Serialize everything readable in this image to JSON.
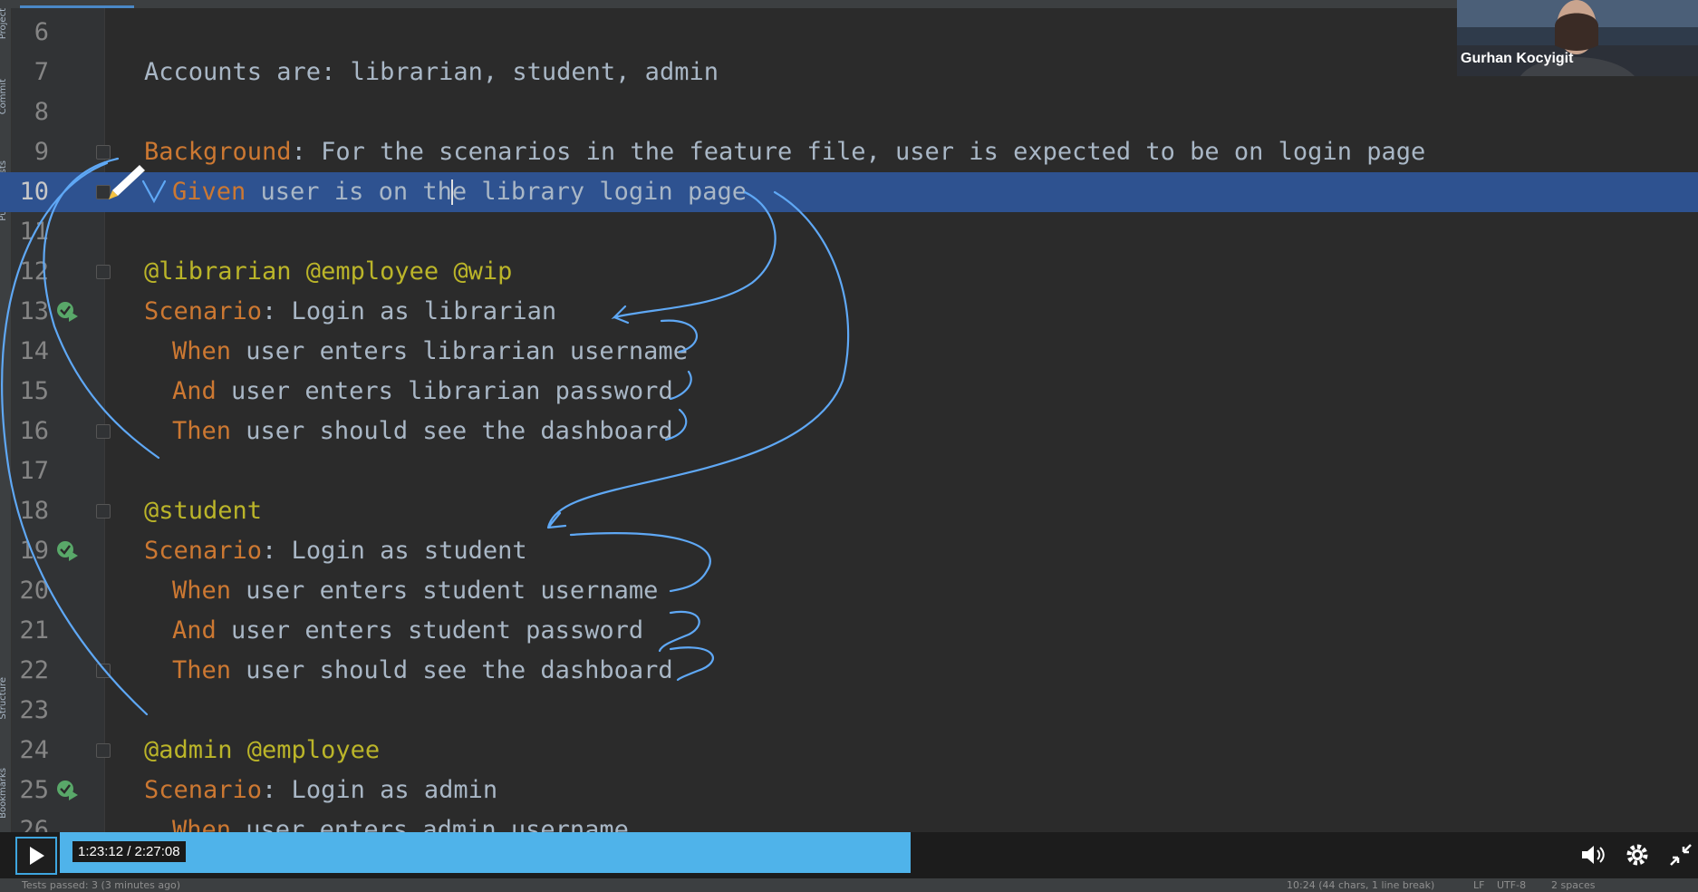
{
  "sidebar": {
    "labels": [
      "Project",
      "Commit",
      "Pull Requests",
      "Structure",
      "Bookmarks"
    ]
  },
  "editor": {
    "lines": [
      {
        "num": "6",
        "parts": []
      },
      {
        "num": "7",
        "parts": [
          {
            "t": "Accounts are: librarian, student, admin",
            "c": "plain"
          }
        ]
      },
      {
        "num": "8",
        "parts": []
      },
      {
        "num": "9",
        "parts": [
          {
            "t": "Background",
            "c": "kw"
          },
          {
            "t": ": For the scenarios in the feature file, user is expected to be on login page",
            "c": "plain"
          }
        ]
      },
      {
        "num": "10",
        "parts": [
          {
            "t": "Given",
            "c": "kw"
          },
          {
            "t": " user is on the library login page",
            "c": "plain"
          }
        ]
      },
      {
        "num": "11",
        "parts": []
      },
      {
        "num": "12",
        "parts": [
          {
            "t": "@librarian @employee @wip",
            "c": "tag"
          }
        ]
      },
      {
        "num": "13",
        "parts": [
          {
            "t": "Scenario",
            "c": "kw"
          },
          {
            "t": ": Login as librarian",
            "c": "plain"
          }
        ]
      },
      {
        "num": "14",
        "parts": [
          {
            "t": "When",
            "c": "kw"
          },
          {
            "t": " user enters librarian username",
            "c": "plain"
          }
        ]
      },
      {
        "num": "15",
        "parts": [
          {
            "t": "And",
            "c": "kw"
          },
          {
            "t": " user enters librarian password",
            "c": "plain"
          }
        ]
      },
      {
        "num": "16",
        "parts": [
          {
            "t": "Then",
            "c": "kw"
          },
          {
            "t": " user should see the dashboard",
            "c": "plain"
          }
        ]
      },
      {
        "num": "17",
        "parts": []
      },
      {
        "num": "18",
        "parts": [
          {
            "t": "@student",
            "c": "tag"
          }
        ]
      },
      {
        "num": "19",
        "parts": [
          {
            "t": "Scenario",
            "c": "kw"
          },
          {
            "t": ": Login as student",
            "c": "plain"
          }
        ]
      },
      {
        "num": "20",
        "parts": [
          {
            "t": "When",
            "c": "kw"
          },
          {
            "t": " user enters student username",
            "c": "plain"
          }
        ]
      },
      {
        "num": "21",
        "parts": [
          {
            "t": "And",
            "c": "kw"
          },
          {
            "t": " user enters student password",
            "c": "plain"
          }
        ]
      },
      {
        "num": "22",
        "parts": [
          {
            "t": "Then",
            "c": "kw"
          },
          {
            "t": " user should see the dashboard",
            "c": "plain"
          }
        ]
      },
      {
        "num": "23",
        "parts": []
      },
      {
        "num": "24",
        "parts": [
          {
            "t": "@admin @employee",
            "c": "tag"
          }
        ]
      },
      {
        "num": "25",
        "parts": [
          {
            "t": "Scenario",
            "c": "kw"
          },
          {
            "t": ": Login as admin",
            "c": "plain"
          }
        ]
      },
      {
        "num": "26",
        "parts": [
          {
            "t": "When",
            "c": "kw"
          },
          {
            "t": " user enters admin username",
            "c": "plain"
          }
        ]
      }
    ],
    "selected_line": "10",
    "run_lines": [
      "13",
      "19",
      "25"
    ],
    "fold_lines": [
      "9",
      "10",
      "12",
      "16",
      "18",
      "22",
      "24"
    ],
    "indented_lines": [
      "10",
      "14",
      "15",
      "16",
      "20",
      "21",
      "22",
      "26"
    ]
  },
  "webcam": {
    "name": "Gurhan Kocyigit"
  },
  "player": {
    "time": "1:23:12 / 2:27:08",
    "progress": 0.5635,
    "icons": [
      "play-icon",
      "volume-icon",
      "settings-icon",
      "exit-fullscreen-icon"
    ]
  },
  "statusbar": {
    "left": "Tests passed: 3 (3 minutes ago)",
    "position": "10:24 (44 chars, 1 line break)",
    "line_sep": "LF",
    "encoding": "UTF-8",
    "indent": "2 spaces"
  },
  "colors": {
    "editor_bg": "#2b2b2b",
    "keyword": "#cc7832",
    "tag": "#bbb529",
    "text": "#a9b7c6",
    "selection": "#2e5290",
    "progress": "#4fb3ea",
    "annotation_ink": "#5fa8f5"
  }
}
